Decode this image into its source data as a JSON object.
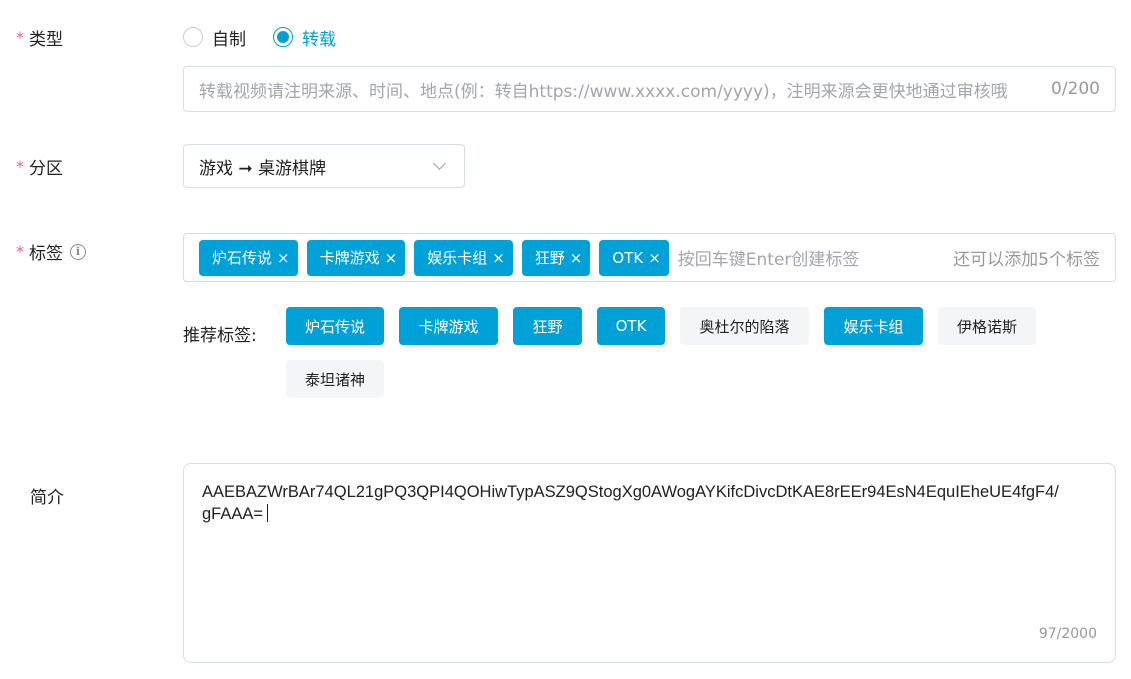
{
  "form": {
    "type": {
      "label": "类型",
      "options": [
        {
          "label": "自制",
          "checked": false
        },
        {
          "label": "转载",
          "checked": true
        }
      ]
    },
    "source": {
      "placeholder": "转载视频请注明来源、时间、地点(例：转自https://www.xxxx.com/yyyy)，注明来源会更快地通过审核哦",
      "count": "0/200"
    },
    "partition": {
      "label": "分区",
      "value": "游戏 ➞ 桌游棋牌"
    },
    "tags": {
      "label": "标签",
      "info_icon": "info-circle-icon",
      "selected": [
        {
          "text": "炉石传说",
          "remove": "×"
        },
        {
          "text": "卡牌游戏",
          "remove": "×"
        },
        {
          "text": "娱乐卡组",
          "remove": "×"
        },
        {
          "text": "狂野",
          "remove": "×"
        },
        {
          "text": "OTK",
          "remove": "×"
        }
      ],
      "input_placeholder": "按回车键Enter创建标签",
      "remaining": "还可以添加5个标签"
    },
    "recommended": {
      "label": "推荐标签:",
      "tags": [
        {
          "text": "炉石传说",
          "active": true
        },
        {
          "text": "卡牌游戏",
          "active": true
        },
        {
          "text": "狂野",
          "active": true
        },
        {
          "text": "OTK",
          "active": true
        },
        {
          "text": "奥杜尔的陷落",
          "active": false
        },
        {
          "text": "娱乐卡组",
          "active": true
        },
        {
          "text": "伊格诺斯",
          "active": false
        },
        {
          "text": "泰坦诸神",
          "active": false
        }
      ]
    },
    "description": {
      "label": "简介",
      "value": "AAEBAZWrBAr74QL21gPQ3QPI4QOHiwTypASZ9QStogXg0AWogAYKifcDivcDtKAE8rEEr94EsN4EquIEheUE4fgF4/gFAAA=",
      "count": "97/2000"
    }
  },
  "colors": {
    "accent": "#00a1d6",
    "required": "#f25d8e",
    "border": "#d7dde4",
    "inactive_tag_bg": "#f4f5f7"
  }
}
